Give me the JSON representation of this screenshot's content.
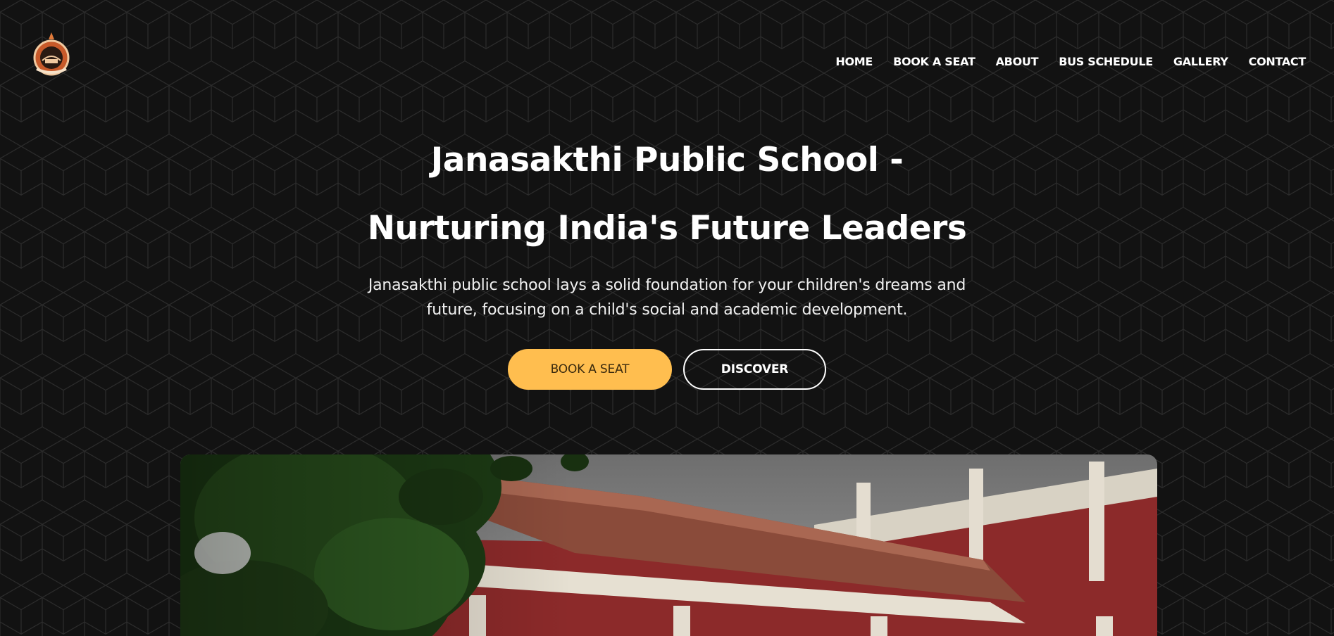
{
  "site": {
    "logo_icon": "school-crest-logo"
  },
  "nav": {
    "items": [
      {
        "label": "HOME"
      },
      {
        "label": "BOOK A SEAT"
      },
      {
        "label": "ABOUT"
      },
      {
        "label": "BUS SCHEDULE"
      },
      {
        "label": "GALLERY"
      },
      {
        "label": "CONTACT"
      }
    ]
  },
  "hero": {
    "title_line1": "Janasakthi Public School -",
    "title_line2": "Nurturing India's Future Leaders",
    "description": "Janasakthi public school lays a solid foundation for your children's dreams and future, focusing on a child's social and academic development.",
    "primary_button": "BOOK A SEAT",
    "secondary_button": "DISCOVER"
  },
  "colors": {
    "background": "#121212",
    "accent": "#ffbe4f",
    "text": "#ffffff"
  }
}
